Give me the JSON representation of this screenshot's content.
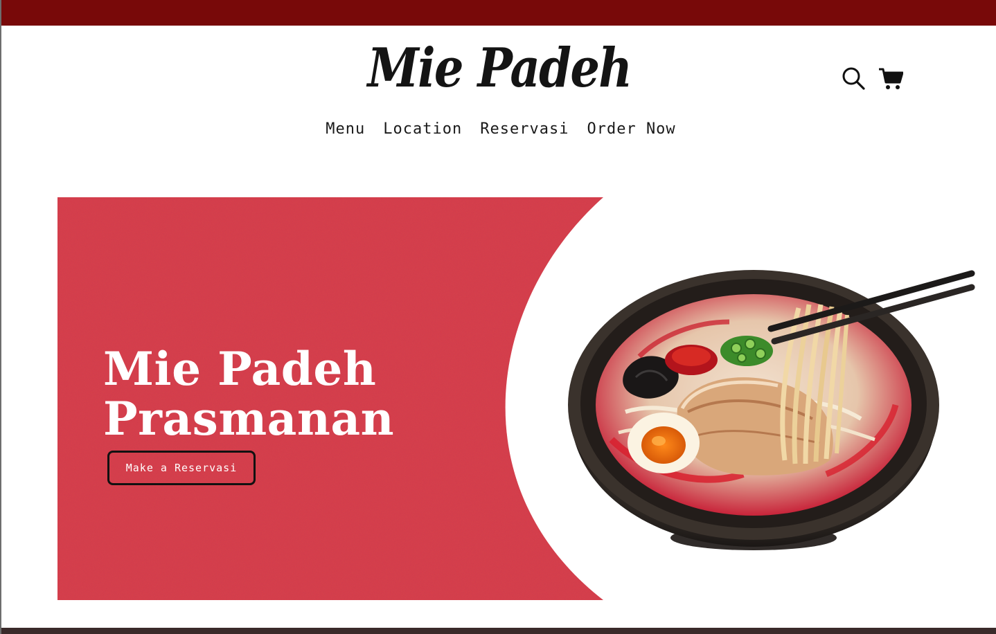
{
  "header": {
    "brand": "Mie Padeh",
    "icons": {
      "search": "search-icon",
      "cart": "cart-icon"
    }
  },
  "nav": {
    "items": [
      {
        "label": "Menu"
      },
      {
        "label": "Location"
      },
      {
        "label": "Reservasi"
      },
      {
        "label": "Order Now"
      }
    ]
  },
  "hero": {
    "title_line1": "Mie Padeh",
    "title_line2": "Prasmanan",
    "cta_label": "Make a Reservasi",
    "image": "ramen-bowl-image"
  },
  "colors": {
    "top_strip": "#780909",
    "hero_red": "#d9414b",
    "text_dark": "#141414",
    "white": "#ffffff"
  }
}
